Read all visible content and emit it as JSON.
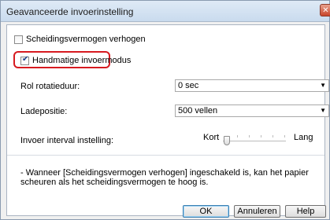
{
  "dialog": {
    "title": "Geavanceerde invoerinstelling",
    "close_glyph": "✕"
  },
  "options": {
    "separation": {
      "label": "Scheidingsvermogen verhogen",
      "checked": false
    },
    "manual_feed": {
      "label": "Handmatige invoermodus",
      "checked": true,
      "check_glyph": "✔"
    }
  },
  "roll_rotation": {
    "label": "Rol rotatieduur:",
    "value": "0 sec"
  },
  "tray_position": {
    "label": "Ladepositie:",
    "value": "500 vellen"
  },
  "feed_interval": {
    "label": "Invoer interval instelling:",
    "min_label": "Kort",
    "max_label": "Lang",
    "level": 0
  },
  "note": "- Wanneer [Scheidingsvermogen verhogen] ingeschakeld is, kan het papier scheuren als het scheidingsvermogen te hoog is.",
  "buttons": {
    "ok": "OK",
    "cancel": "Annuleren",
    "help": "Help"
  },
  "colors": {
    "highlight": "#d71a20",
    "titlebar": "#c9dbee"
  }
}
